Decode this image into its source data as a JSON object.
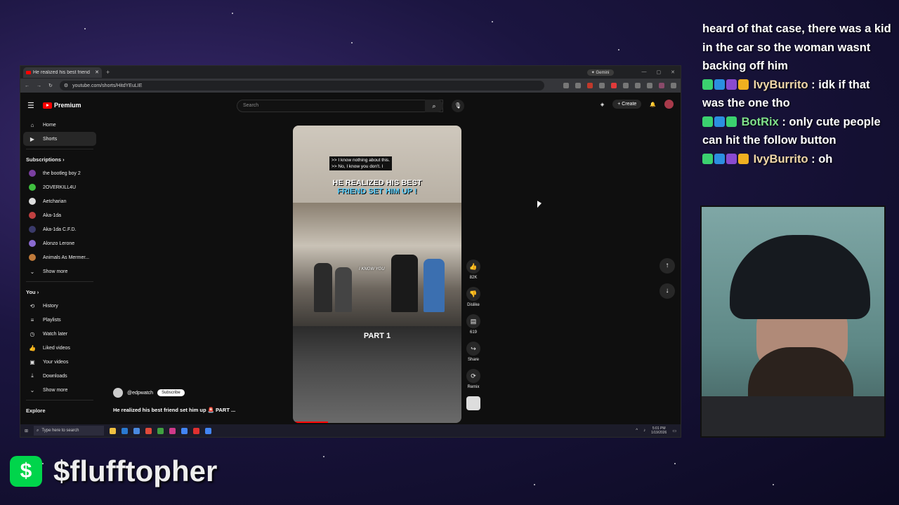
{
  "browser": {
    "tab_title": "He realized his best friend",
    "new_tab": "+",
    "gemini_label": "✦ Gemini",
    "url": "youtube.com/shorts/HitdYEuLIE"
  },
  "youtube": {
    "brand": "Premium",
    "search_placeholder": "Search",
    "create_label": "+ Create",
    "sidebar": {
      "main": [
        {
          "label": "Home",
          "icon": "home-icon"
        },
        {
          "label": "Shorts",
          "icon": "shorts-icon"
        }
      ],
      "subscriptions_heading": "Subscriptions ›",
      "subscriptions": [
        {
          "label": "the bootleg boy 2",
          "color": "#7a3fa0"
        },
        {
          "label": "2OVERKILL4U",
          "color": "#3fbf3f"
        },
        {
          "label": "Aetcharian",
          "color": "#dddddd"
        },
        {
          "label": "Aka-1da",
          "color": "#c04040"
        },
        {
          "label": "Aka-1da C.F.D.",
          "color": "#3a3a6a"
        },
        {
          "label": "Alonzo Lerone",
          "color": "#8a6ad0"
        },
        {
          "label": "Animals As Mermer...",
          "color": "#c07a3a"
        }
      ],
      "show_more": "Show more",
      "you_heading": "You ›",
      "you_items": [
        {
          "label": "History",
          "icon": "history-icon"
        },
        {
          "label": "Playlists",
          "icon": "playlists-icon"
        },
        {
          "label": "Watch later",
          "icon": "watch-later-icon"
        },
        {
          "label": "Liked videos",
          "icon": "liked-icon"
        },
        {
          "label": "Your videos",
          "icon": "your-videos-icon"
        },
        {
          "label": "Downloads",
          "icon": "downloads-icon"
        }
      ],
      "show_more_2": "Show more",
      "explore_heading": "Explore"
    },
    "short": {
      "caption_line1": ">> I know nothing about this.",
      "caption_line2": ">> No, I know you don't. I",
      "headline_line1": "HE REALIZED HIS BEST",
      "headline_line2": "FRIEND SET HIM UP !",
      "scene_caption": "I KNOW YOU",
      "part_label": "PART 1"
    },
    "actions": {
      "likes": "82K",
      "dislike": "Dislike",
      "comments": "619",
      "share": "Share",
      "remix": "Remix"
    },
    "channel_handle": "@edpwatch",
    "subscribe_label": "Subscribe",
    "video_title": "He realized his best friend set him up 🚨 PART ..."
  },
  "taskbar": {
    "search_placeholder": "Type here to search",
    "time": "5:01 PM",
    "date": "1/19/2026"
  },
  "chat": {
    "line1_text": "heard of that case, there was a kid in the car so the woman wasnt backing off him",
    "messages": [
      {
        "user": "IvyBurrito",
        "text": " : idk if that was the one tho"
      },
      {
        "user": "BotRix",
        "text": " : only cute people can hit the follow button"
      },
      {
        "user": "IvyBurrito",
        "text": " : oh"
      }
    ]
  },
  "cashtag": {
    "logo": "$",
    "name": "$flufftopher"
  },
  "colors": {
    "accent_red": "#ff0000",
    "cashapp_green": "#00d54b",
    "bg_dark": "#0f0f0f"
  }
}
